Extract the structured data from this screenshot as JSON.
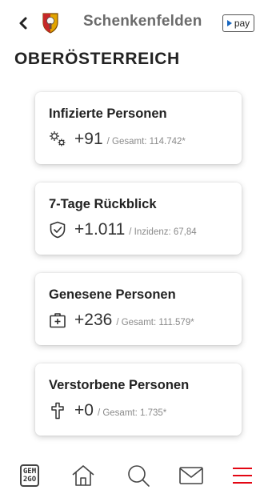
{
  "header": {
    "title": "Schenkenfelden",
    "pay_label": "pay"
  },
  "region": {
    "title": "OBERÖSTERREICH"
  },
  "cards": [
    {
      "title": "Infizierte Personen",
      "value": "+91",
      "sub": "/ Gesamt: 114.742*",
      "icon": "virus-icon"
    },
    {
      "title": "7-Tage Rückblick",
      "value": "+1.011",
      "sub": "/ Inzidenz: 67,84",
      "icon": "shield-check-icon"
    },
    {
      "title": "Genesene Personen",
      "value": "+236",
      "sub": "/ Gesamt: 111.579*",
      "icon": "first-aid-icon"
    },
    {
      "title": "Verstorbene Personen",
      "value": "+0",
      "sub": "/ Gesamt: 1.735*",
      "icon": "cross-icon"
    }
  ],
  "bottom_nav": {
    "gem_line1": "GEM",
    "gem_line2": "2GO",
    "items": [
      "gem2go-icon",
      "home-icon",
      "search-icon",
      "mail-icon",
      "menu-icon"
    ]
  },
  "colors": {
    "accent": "#e30613",
    "pay_play": "#1565c0",
    "title_gray": "#6b6b6b"
  }
}
